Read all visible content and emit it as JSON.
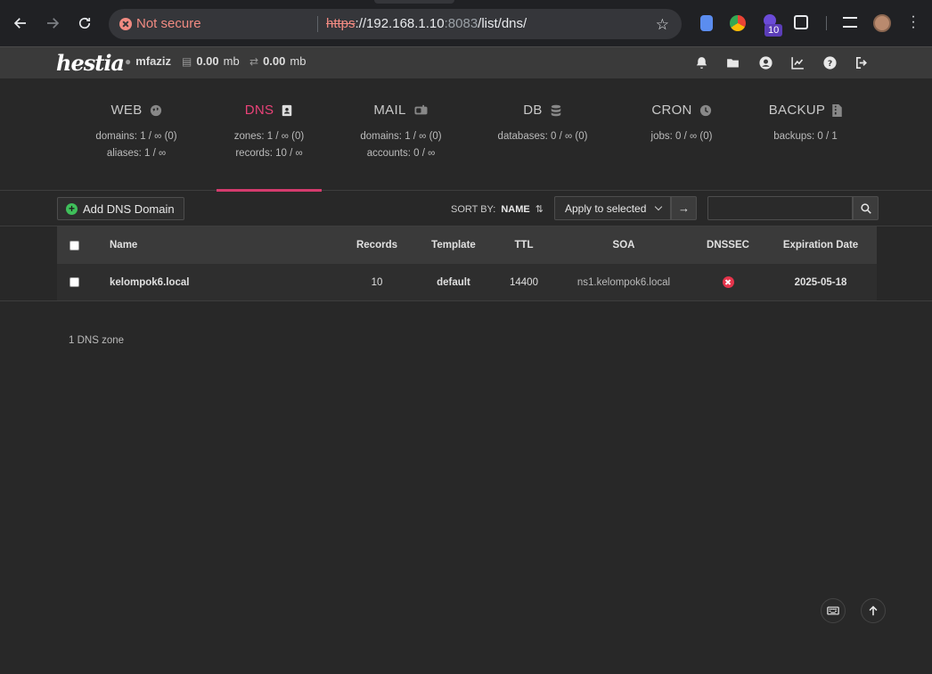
{
  "browser": {
    "security_label": "Not secure",
    "url_scheme": "https",
    "url_host": "://192.168.1.10",
    "url_port": ":8083",
    "url_path": "/list/dns/",
    "extension_badge": "10"
  },
  "topbar": {
    "logo": "hestia",
    "username": "mfaziz",
    "disk_usage": "0.00",
    "disk_unit": "mb",
    "bandwidth_usage": "0.00",
    "bandwidth_unit": "mb"
  },
  "tabs": [
    {
      "title": "WEB",
      "icon": "globe-icon",
      "lines": [
        "domains: 1 / ∞ (0)",
        "aliases: 1 / ∞"
      ]
    },
    {
      "title": "DNS",
      "icon": "address-book-icon",
      "lines": [
        "zones: 1 / ∞ (0)",
        "records: 10 / ∞"
      ],
      "active": true
    },
    {
      "title": "MAIL",
      "icon": "mailbox-icon",
      "lines": [
        "domains: 1 / ∞ (0)",
        "accounts: 0 / ∞"
      ]
    },
    {
      "title": "DB",
      "icon": "database-icon",
      "lines": [
        "databases: 0 / ∞ (0)"
      ]
    },
    {
      "title": "CRON",
      "icon": "clock-icon",
      "lines": [
        "jobs: 0 / ∞ (0)"
      ]
    },
    {
      "title": "BACKUP",
      "icon": "file-zipper-icon",
      "lines": [
        "backups: 0 / 1"
      ]
    }
  ],
  "toolbar": {
    "add_label": "Add DNS Domain",
    "sort_prefix": "SORT BY:",
    "sort_field": "NAME",
    "apply_label": "Apply to selected",
    "search_value": ""
  },
  "table": {
    "headers": {
      "name": "Name",
      "records": "Records",
      "template": "Template",
      "ttl": "TTL",
      "soa": "SOA",
      "dnssec": "DNSSEC",
      "expiration": "Expiration Date"
    },
    "rows": [
      {
        "name": "kelompok6.local",
        "records": "10",
        "template": "default",
        "ttl": "14400",
        "soa": "ns1.kelompok6.local",
        "dnssec": "disabled",
        "expiration": "2025-05-18"
      }
    ]
  },
  "footer": {
    "count": "1 DNS zone"
  },
  "colors": {
    "accent": "#d43b6d",
    "add_green": "#3fbf5a",
    "dnssec_off": "#e5344b"
  }
}
